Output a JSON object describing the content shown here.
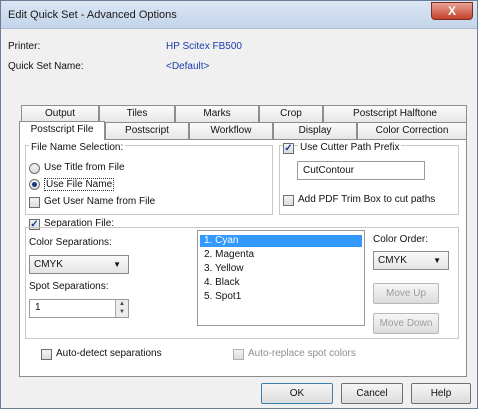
{
  "window": {
    "title": "Edit Quick Set - Advanced Options",
    "close_symbol": "X"
  },
  "header": {
    "printer_label": "Printer:",
    "printer_value": "HP Scitex FB500",
    "quickset_label": "Quick Set Name:",
    "quickset_value": "<Default>"
  },
  "tabs_row1": [
    "Output",
    "Tiles",
    "Marks",
    "Crop",
    "Postscript Halftone"
  ],
  "tabs_row2": [
    "Postscript File",
    "Postscript",
    "Workflow",
    "Display",
    "Color Correction"
  ],
  "active_tab": "Postscript File",
  "file_name_selection": {
    "group_label": "File Name Selection:",
    "use_title": "Use Title from File",
    "use_filename": "Use File Name",
    "selected": "Use File Name",
    "get_user_name": "Get User Name from File",
    "get_user_name_checked": false
  },
  "cutter": {
    "use_cutter_label": "Use Cutter Path Prefix",
    "use_cutter_checked": true,
    "prefix_value": "CutContour",
    "add_pdf_label": "Add PDF Trim Box to cut paths",
    "add_pdf_checked": false
  },
  "separation": {
    "label": "Separation File:",
    "checked": true,
    "color_separations_label": "Color Separations:",
    "color_separations_value": "CMYK",
    "spot_separations_label": "Spot Separations:",
    "spot_separations_value": "1",
    "list_items": [
      "1. Cyan",
      "2. Magenta",
      "3. Yellow",
      "4. Black",
      "5. Spot1"
    ],
    "selected_index": 0,
    "color_order_label": "Color Order:",
    "color_order_value": "CMYK",
    "move_up": "Move Up",
    "move_down": "Move Down"
  },
  "auto_detect": {
    "label": "Auto-detect separations",
    "checked": false
  },
  "auto_replace": {
    "label": "Auto-replace spot colors",
    "checked": false
  },
  "footer": {
    "ok": "OK",
    "cancel": "Cancel",
    "help": "Help"
  },
  "icons": {
    "check": "✓",
    "dropdown": "▼",
    "up": "▲",
    "down": "▼"
  }
}
